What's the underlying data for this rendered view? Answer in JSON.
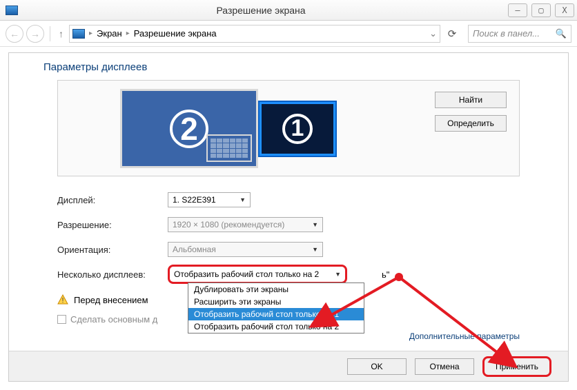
{
  "window": {
    "title": "Разрешение экрана"
  },
  "winbuttons": {
    "min": "—",
    "max": "▢",
    "close": "X"
  },
  "breadcrumb": {
    "item1": "Экран",
    "item2": "Разрешение экрана",
    "chev": "▸",
    "dropchev": "⌄"
  },
  "search": {
    "placeholder": "Поиск в панел...",
    "icon": "🔍"
  },
  "heading": "Параметры дисплеев",
  "monitors": {
    "num1": "1",
    "num2": "2"
  },
  "sidebuttons": {
    "find": "Найти",
    "identify": "Определить"
  },
  "form": {
    "display_label": "Дисплей:",
    "display_value": "1. S22E391",
    "resolution_label": "Разрешение:",
    "resolution_value": "1920 × 1080 (рекомендуется)",
    "orientation_label": "Ориентация:",
    "orientation_value": "Альбомная",
    "multi_label": "Несколько дисплеев:",
    "multi_value": "Отобразить рабочий стол только на 2"
  },
  "dropdown": {
    "opt1": "Дублировать эти экраны",
    "opt2": "Расширить эти экраны",
    "opt3": "Отобразить рабочий стол только на 1",
    "opt4": "Отобразить рабочий стол только на 2"
  },
  "warning": {
    "text": "Перед внесением"
  },
  "warning_tail": "ь\"",
  "checkbox": {
    "label": "Сделать основным д"
  },
  "advanced": "Дополнительные параметры",
  "footer": {
    "ok": "OK",
    "cancel": "Отмена",
    "apply": "Применить"
  }
}
